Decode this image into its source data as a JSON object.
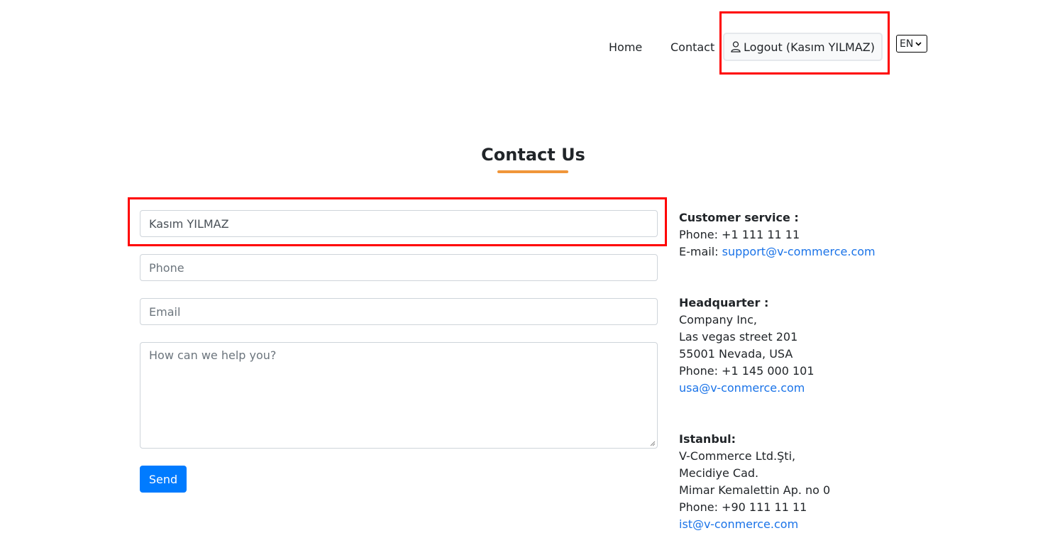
{
  "nav": {
    "home": "Home",
    "contact": "Contact",
    "logout": "Logout (Kasım YILMAZ)",
    "logout_icon": "user-icon",
    "language": "EN"
  },
  "page": {
    "title": "Contact Us"
  },
  "form": {
    "name_value": "Kasım YILMAZ",
    "phone_placeholder": "Phone",
    "email_placeholder": "Email",
    "message_placeholder": "How can we help you?",
    "send_label": "Send"
  },
  "info": {
    "customer": {
      "heading": "Customer service :",
      "phone": "Phone: +1 111 11 11",
      "email_label": "E-mail: ",
      "email": "support@v-commerce.com"
    },
    "hq": {
      "heading": "Headquarter :",
      "company": "Company Inc,",
      "street": "Las vegas street 201",
      "city": "55001 Nevada, USA",
      "phone": "Phone: +1 145 000 101",
      "email": "usa@v-conmerce.com"
    },
    "istanbul": {
      "heading": "Istanbul:",
      "company": "V-Commerce Ltd.Şti,",
      "street": "Mecidiye Cad.",
      "address": "Mimar Kemalettin Ap. no 0",
      "phone": "Phone: +90 111 11 11",
      "email": "ist@v-conmerce.com"
    }
  },
  "colors": {
    "accent_underline": "#f0963a",
    "primary_button": "#007bff",
    "link": "#1a73e8",
    "highlight": "#ff0000"
  }
}
